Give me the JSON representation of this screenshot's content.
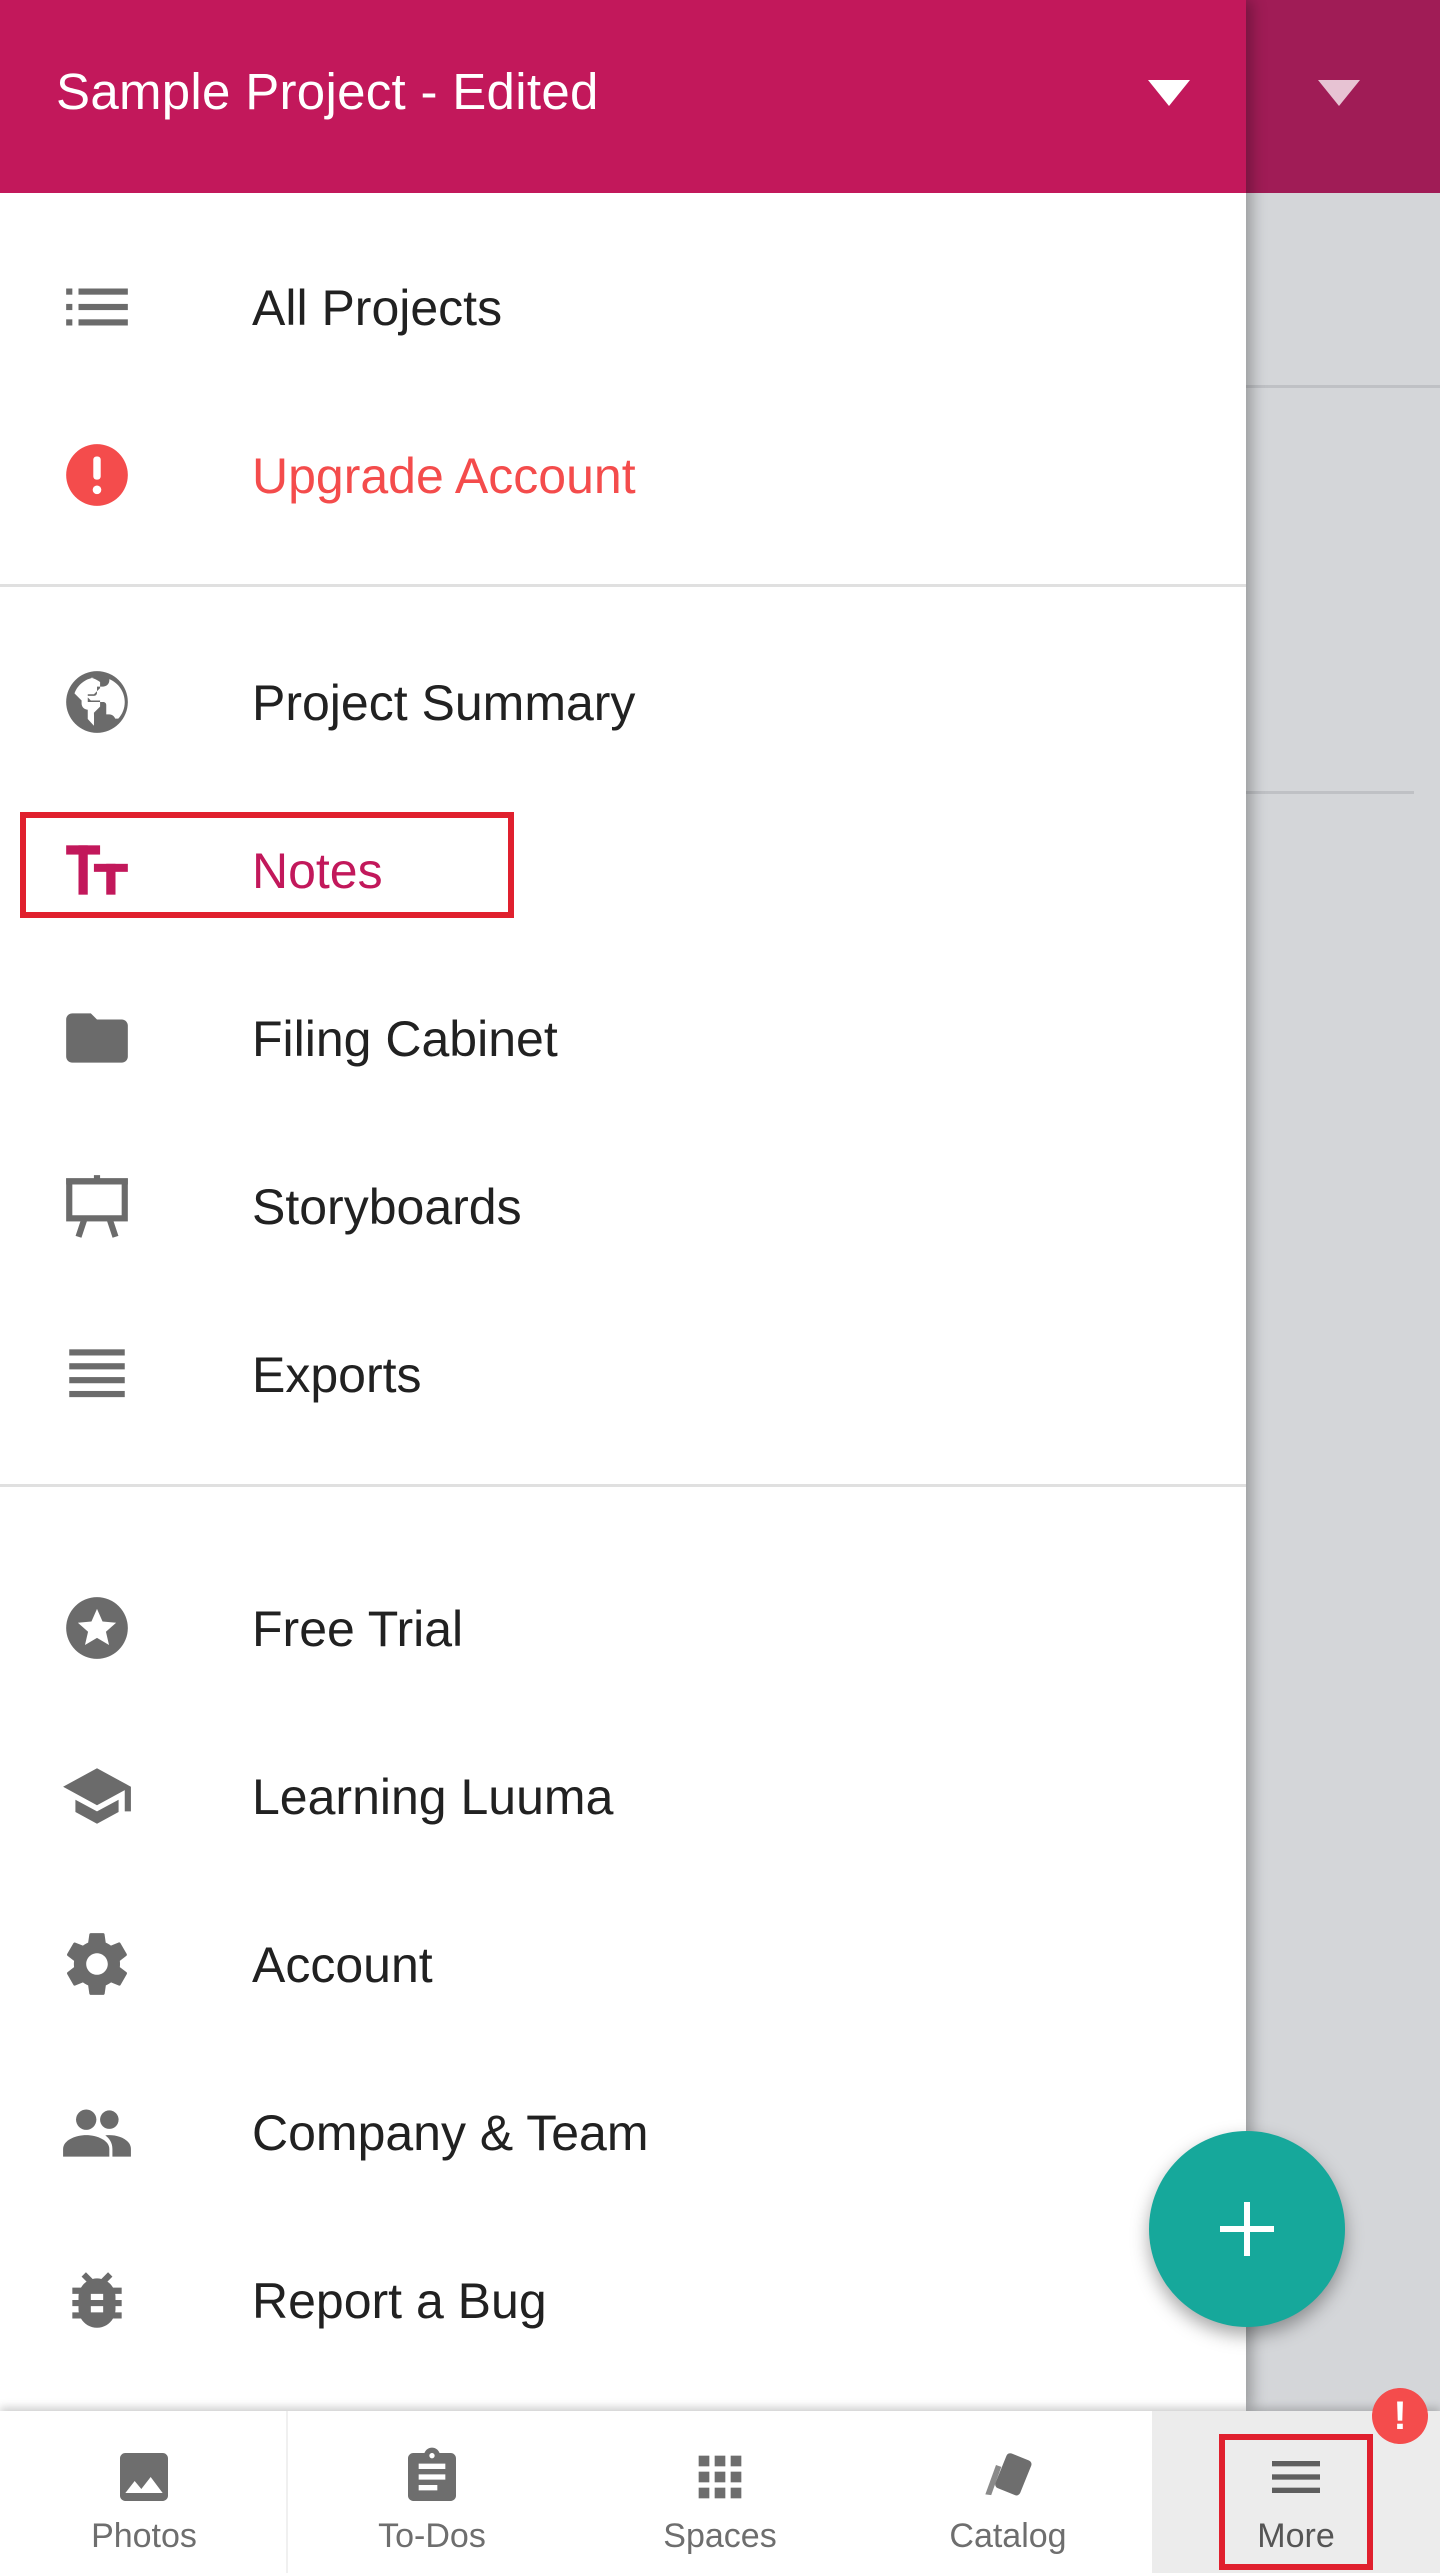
{
  "header": {
    "project_title": "Sample Project - Edited"
  },
  "drawer": {
    "section1": [
      {
        "label": "All Projects",
        "icon": "list-icon"
      },
      {
        "label": "Upgrade Account",
        "icon": "alert-circle-icon",
        "color": "#f44c4c"
      }
    ],
    "section2": [
      {
        "label": "Project Summary",
        "icon": "globe-icon"
      },
      {
        "label": "Notes",
        "icon": "text-format-icon",
        "color": "#c2185b",
        "selected": true
      },
      {
        "label": "Filing Cabinet",
        "icon": "folder-icon"
      },
      {
        "label": "Storyboards",
        "icon": "easel-icon"
      },
      {
        "label": "Exports",
        "icon": "lines-icon"
      }
    ],
    "section3": [
      {
        "label": "Free Trial",
        "icon": "star-circle-icon"
      },
      {
        "label": "Learning Luuma",
        "icon": "graduation-cap-icon"
      },
      {
        "label": "Account",
        "icon": "gear-icon"
      },
      {
        "label": "Company & Team",
        "icon": "people-icon"
      },
      {
        "label": "Report a Bug",
        "icon": "bug-icon"
      }
    ]
  },
  "fab": {
    "icon": "plus-icon",
    "color": "#16a89b"
  },
  "bottom_nav": {
    "items": [
      {
        "label": "Photos",
        "icon": "image-icon"
      },
      {
        "label": "To-Dos",
        "icon": "clipboard-icon"
      },
      {
        "label": "Spaces",
        "icon": "grid-icon"
      },
      {
        "label": "Catalog",
        "icon": "swatch-icon"
      },
      {
        "label": "More",
        "icon": "menu-icon",
        "active": true
      }
    ],
    "badge": "!"
  },
  "colors": {
    "brand": "#c2185b",
    "brand_dim": "#a01c56",
    "alert": "#f44c4c",
    "icon_gray": "#6b6b6b",
    "highlight": "#e0202e"
  }
}
